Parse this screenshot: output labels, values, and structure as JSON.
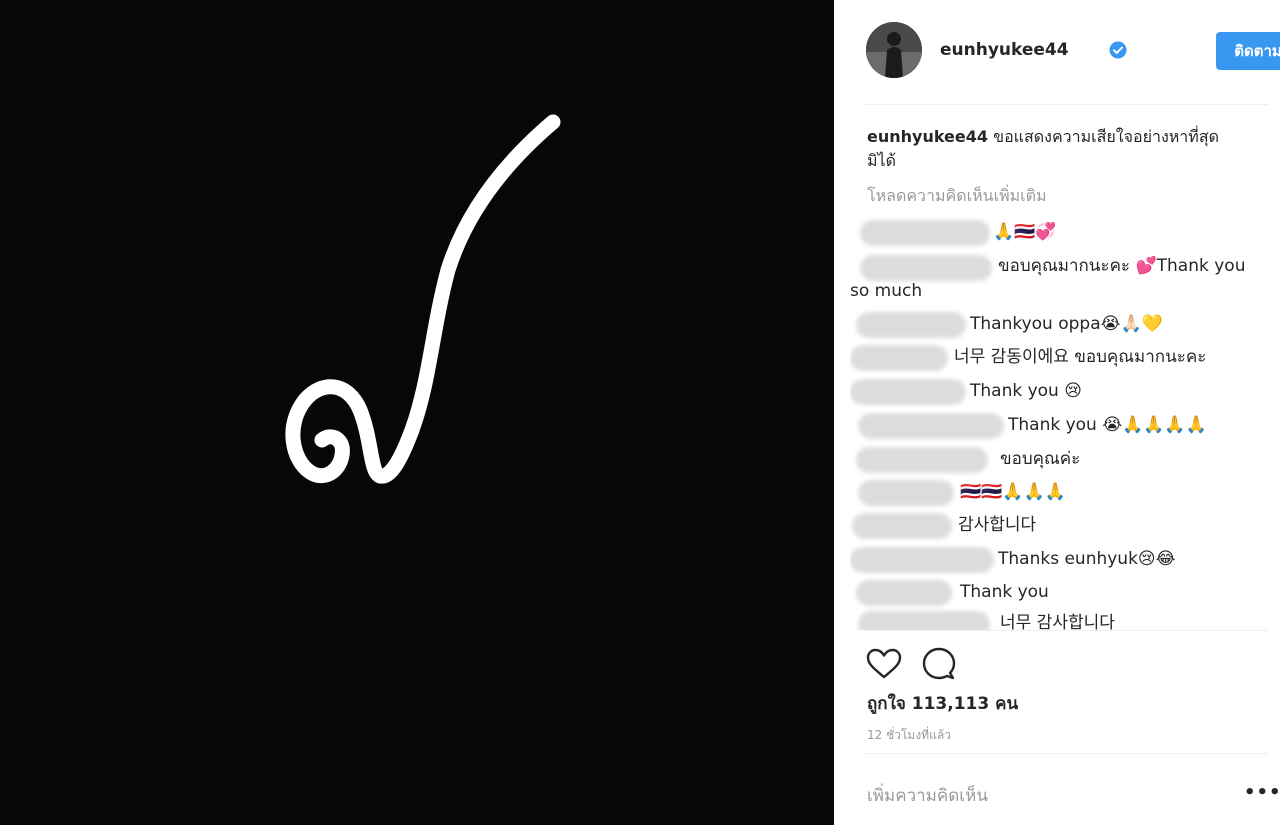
{
  "post": {
    "glyph": "๙"
  },
  "header": {
    "username": "eunhyukee44",
    "follow_label": "ติดตาม"
  },
  "caption": {
    "username": "eunhyukee44",
    "text": "ขอแสดงความเสียใจอย่างหาที่สุดมิได้"
  },
  "load_more": "โหลดความคิดเห็นเพิ่มเติม",
  "comments": [
    {
      "text": "🙏🇹🇭💞"
    },
    {
      "text": "ขอบคุณมากนะคะ 💕Thank you so much"
    },
    {
      "text": "Thankyou oppa😭🙏🏻💛"
    },
    {
      "text": "너무 감동이에요 ขอบคุณมากนะคะ"
    },
    {
      "text": "Thank you 😢"
    },
    {
      "text": "Thank you 😭🙏🙏🙏🙏"
    },
    {
      "text": "ขอบคุณค่ะ"
    },
    {
      "text": "🇹🇭🇹🇭🙏🙏🙏"
    },
    {
      "text": "감사합니다"
    },
    {
      "text": "Thanks eunhyuk😢😂"
    },
    {
      "text": "Thank you"
    },
    {
      "text": "너무 감사합니다"
    }
  ],
  "likes": "ถูกใจ 113,113 คน",
  "time": "12 ชั่วโมงที่แล้ว",
  "add_comment_placeholder": "เพิ่มความคิดเห็น",
  "more_options": "•••",
  "icons": {
    "like": "heart-icon",
    "comment": "comment-icon",
    "verified": "verified-badge-icon",
    "more": "more-options-icon"
  },
  "colors": {
    "follow_button": "#3897f0",
    "media_background": "#070707",
    "muted_text": "#999999"
  }
}
